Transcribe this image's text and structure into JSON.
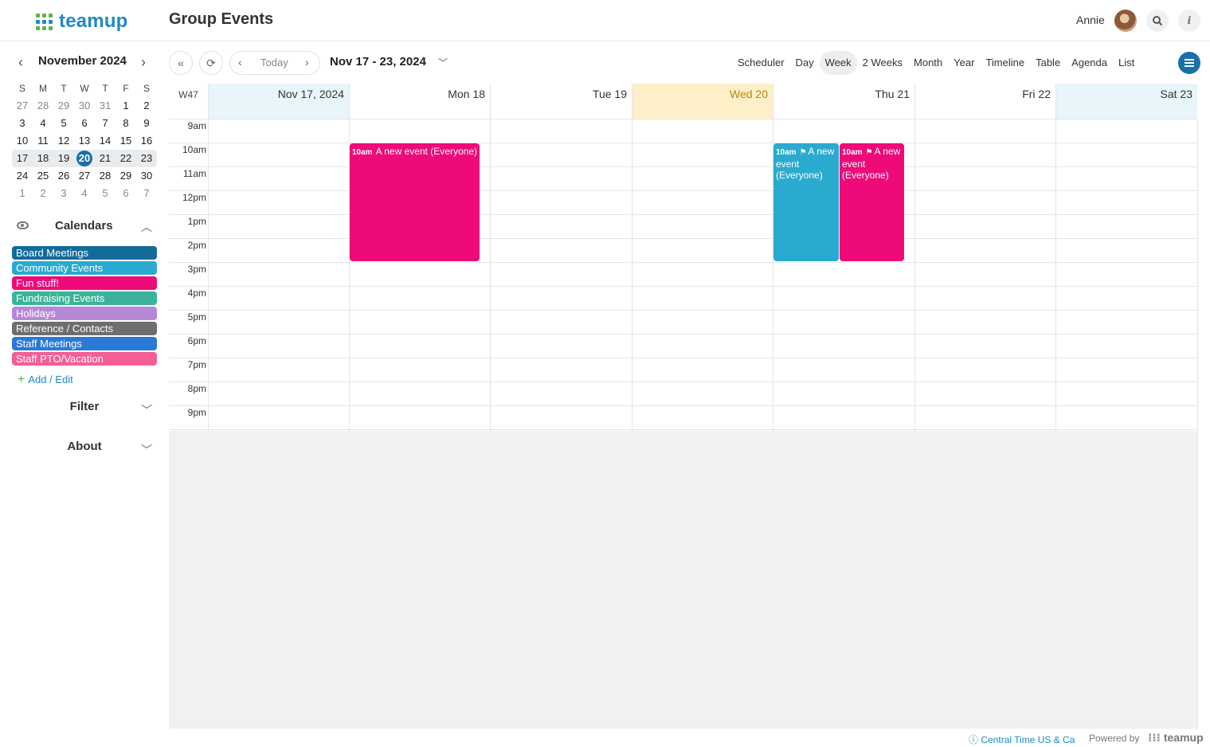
{
  "header": {
    "logo": "teamup",
    "title": "Group Events",
    "user": "Annie"
  },
  "mini_calendar": {
    "title": "November 2024",
    "dow": [
      "S",
      "M",
      "T",
      "W",
      "T",
      "F",
      "S"
    ],
    "weeks": [
      [
        "27",
        "28",
        "29",
        "30",
        "31",
        "1",
        "2"
      ],
      [
        "3",
        "4",
        "5",
        "6",
        "7",
        "8",
        "9"
      ],
      [
        "10",
        "11",
        "12",
        "13",
        "14",
        "15",
        "16"
      ],
      [
        "17",
        "18",
        "19",
        "20",
        "21",
        "22",
        "23"
      ],
      [
        "24",
        "25",
        "26",
        "27",
        "28",
        "29",
        "30"
      ],
      [
        "1",
        "2",
        "3",
        "4",
        "5",
        "6",
        "7"
      ]
    ],
    "today": "20"
  },
  "calendars": {
    "title": "Calendars",
    "items": [
      {
        "label": "Board Meetings",
        "color": "#136a9b"
      },
      {
        "label": "Community Events",
        "color": "#2baacf"
      },
      {
        "label": "Fun stuff!",
        "color": "#ee0a78"
      },
      {
        "label": "Fundraising Events",
        "color": "#3bb39a"
      },
      {
        "label": "Holidays",
        "color": "#b688d8"
      },
      {
        "label": "Reference / Contacts",
        "color": "#6e6e6e"
      },
      {
        "label": "Staff Meetings",
        "color": "#2a79d6"
      },
      {
        "label": "Staff PTO/Vacation",
        "color": "#f45e95"
      }
    ],
    "add_edit": "Add / Edit"
  },
  "sections": {
    "filter": "Filter",
    "about": "About"
  },
  "toolbar": {
    "today": "Today",
    "range": "Nov 17 - 23, 2024",
    "views": [
      "Scheduler",
      "Day",
      "Week",
      "2 Weeks",
      "Month",
      "Year",
      "Timeline",
      "Table",
      "Agenda",
      "List"
    ],
    "active_view": "Week"
  },
  "week": {
    "label": "W47",
    "days": [
      "Nov 17, 2024",
      "Mon 18",
      "Tue 19",
      "Wed 20",
      "Thu 21",
      "Fri 22",
      "Sat 23"
    ],
    "times": [
      "9am",
      "10am",
      "11am",
      "12pm",
      "1pm",
      "2pm",
      "3pm",
      "4pm",
      "5pm",
      "6pm",
      "7pm",
      "8pm",
      "9pm"
    ]
  },
  "events": [
    {
      "day": 1,
      "start": "10am",
      "title": "A new event (Everyone)",
      "color": "#ee0a78",
      "flag": false
    },
    {
      "day": 4,
      "start": "10am",
      "title": "A new event (Everyone)",
      "color": "#2baacf",
      "flag": true
    },
    {
      "day": 4,
      "start": "10am",
      "title": "A new event (Everyone)",
      "color": "#ee0a78",
      "flag": true
    }
  ],
  "footer": {
    "timezone": "Central Time US & Ca",
    "powered": "Powered by",
    "brand": "teamup"
  }
}
